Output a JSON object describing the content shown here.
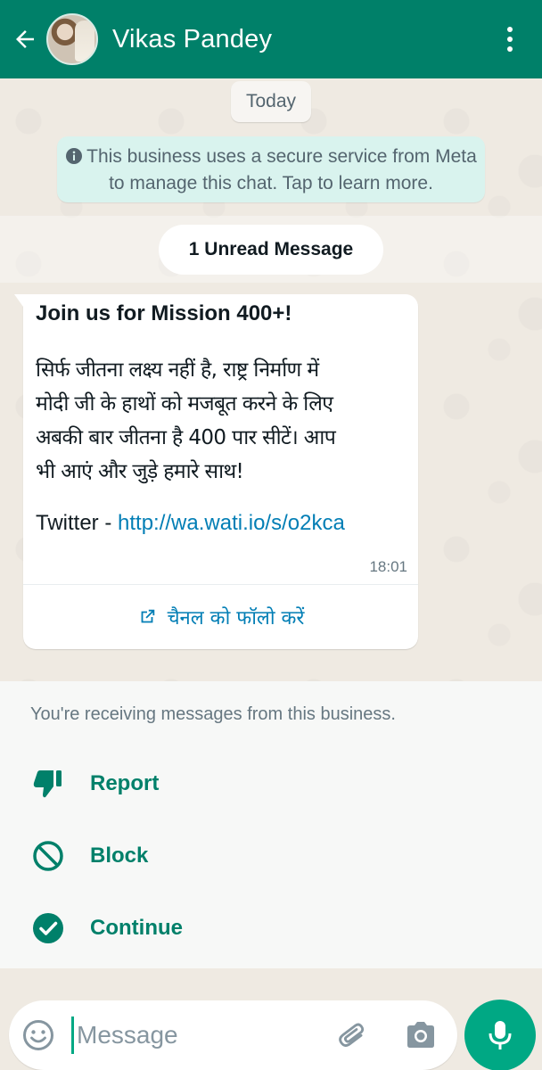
{
  "header": {
    "contact_name": "Vikas Pandey",
    "back_icon": "arrow-left-icon",
    "menu_icon": "more-vertical-icon",
    "color": "#008069"
  },
  "chat": {
    "date_label": "Today",
    "system_message": "This business uses a secure service from Meta to manage this chat. Tap to learn more.",
    "unread_label": "1 Unread Message",
    "message": {
      "title": "Join us for Mission 400+!",
      "body_lines": [
        "सिर्फ जीतना लक्ष्य नहीं है, राष्ट्र निर्माण में",
        "मोदी जी के हाथों को मजबूत करने के लिए",
        "अबकी बार जीतना है 400 पार सीटें। आप",
        "भी आएं और जुड़े हमारे साथ!"
      ],
      "twitter_prefix": "Twitter - ",
      "twitter_link": "http://wa.wati.io/s/o2kca",
      "time": "18:01",
      "cta_label": "चैनल को फॉलो करें",
      "link_color": "#027eb5"
    }
  },
  "business_panel": {
    "note": "You're receiving messages from this business.",
    "actions": [
      {
        "label": "Report",
        "icon": "thumbs-down-icon"
      },
      {
        "label": "Block",
        "icon": "block-icon"
      },
      {
        "label": "Continue",
        "icon": "check-circle-icon"
      }
    ],
    "accent": "#00806a"
  },
  "composer": {
    "placeholder": "Message",
    "value": "",
    "emoji_icon": "emoji-icon",
    "attach_icon": "paperclip-icon",
    "camera_icon": "camera-icon",
    "mic_icon": "mic-icon",
    "send_color": "#00a884"
  }
}
